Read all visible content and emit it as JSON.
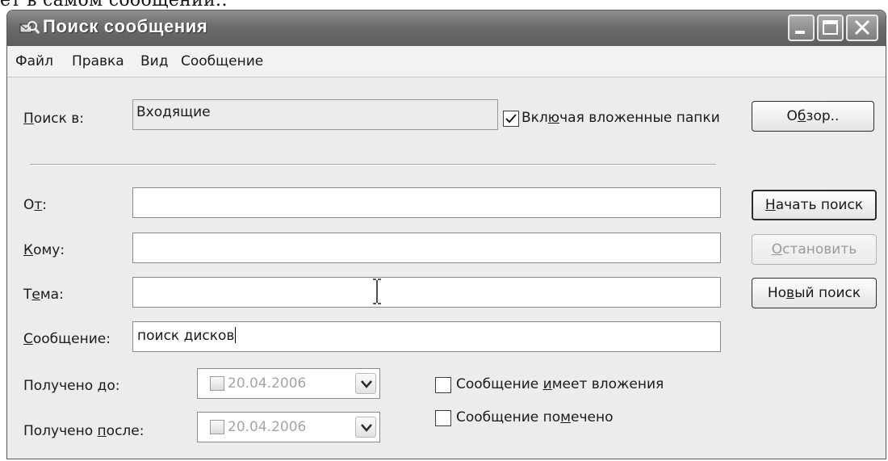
{
  "background_text": "ет в самом сообщении.:",
  "window": {
    "title": "Поиск сообщения",
    "controls": [
      "minimize-icon",
      "maximize-icon",
      "close-icon"
    ]
  },
  "menu": [
    {
      "label": "Файл"
    },
    {
      "label": "Правка"
    },
    {
      "label": "Вид"
    },
    {
      "label": "Сообщение"
    }
  ],
  "search_in": {
    "label_ul": "П",
    "label_rest": "оиск в:",
    "value": "Входящие",
    "subfolders_checked": true,
    "subfolders_pre": "Вкл",
    "subfolders_ul": "ю",
    "subfolders_post": "чая вложенные папки",
    "browse_pre": "О",
    "browse_ul": "б",
    "browse_post": "зор.."
  },
  "fields": {
    "from": {
      "label_pre": "О",
      "label_ul": "т",
      "label_post": ":",
      "value": ""
    },
    "to": {
      "label_ul": "К",
      "label_rest": "ому:",
      "value": ""
    },
    "subject": {
      "label_pre": "Т",
      "label_ul": "е",
      "label_post": "ма:",
      "value": ""
    },
    "message": {
      "label_ul": "С",
      "label_rest": "ообщение:",
      "value": "поиск дисков"
    }
  },
  "buttons": {
    "start": {
      "ul": "Н",
      "rest": "ачать поиск"
    },
    "stop": {
      "ul": "О",
      "rest": "становить",
      "enabled": false
    },
    "new": {
      "pre": "Но",
      "ul": "в",
      "post": "ый поиск"
    }
  },
  "dates": {
    "before": {
      "label_pre": "Получено ",
      "label_ul": "д",
      "label_post": "о:",
      "value": "20.04.2006",
      "enabled": false
    },
    "after": {
      "label_pre": "Получено ",
      "label_ul": "п",
      "label_post": "осле:",
      "value": "20.04.2006",
      "enabled": false
    }
  },
  "options": {
    "has_attachments": {
      "checked": false,
      "pre": "Сообщение ",
      "ul": "и",
      "post": "меет вложения"
    },
    "flagged": {
      "checked": false,
      "pre": "Сообщение по",
      "ul": "м",
      "post": "ечено"
    }
  },
  "colors": {
    "titlebar": "#6c6c6c",
    "dialog_bg": "#ececec",
    "field_bg": "#ffffff",
    "disabled_text": "#9a9a9a"
  }
}
